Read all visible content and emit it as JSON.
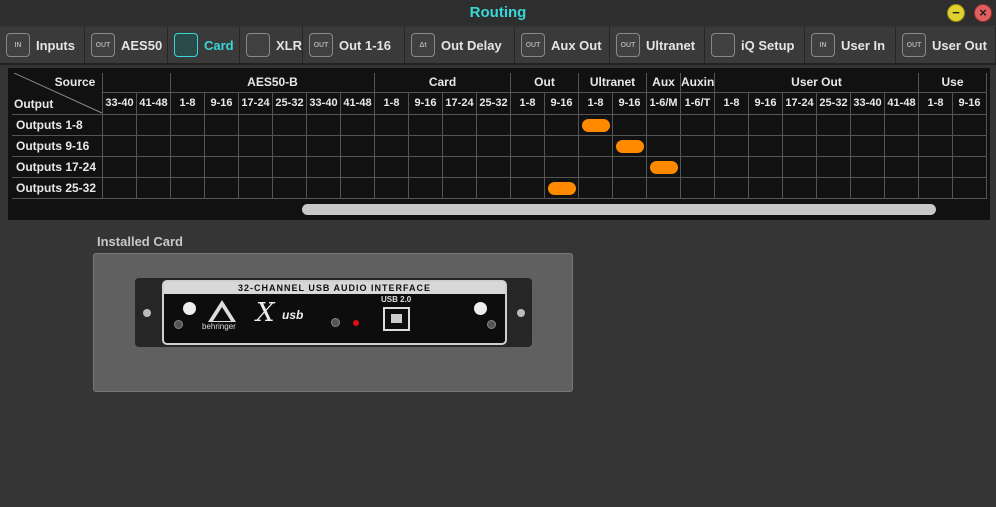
{
  "window": {
    "title": "Routing",
    "minimize_glyph": "−",
    "close_glyph": "×"
  },
  "tabs": [
    {
      "label": "Inputs",
      "icon": "in-connector-icon",
      "icon_text": "IN"
    },
    {
      "label": "AES50",
      "icon": "out-connector-icon",
      "icon_text": "OUT"
    },
    {
      "label": "Card",
      "icon": "card-icon",
      "icon_text": "",
      "active": true
    },
    {
      "label": "XLR",
      "icon": "xlr-icon",
      "icon_text": ""
    },
    {
      "label": "Out 1-16",
      "icon": "out-connector-icon",
      "icon_text": "OUT"
    },
    {
      "label": "Out Delay",
      "icon": "delay-icon",
      "icon_text": "Δt"
    },
    {
      "label": "Aux Out",
      "icon": "out-connector-icon",
      "icon_text": "OUT"
    },
    {
      "label": "Ultranet",
      "icon": "out-connector-icon",
      "icon_text": "OUT"
    },
    {
      "label": "iQ Setup",
      "icon": "speaker-icon",
      "icon_text": ""
    },
    {
      "label": "User In",
      "icon": "in-connector-icon",
      "icon_text": "IN"
    },
    {
      "label": "User Out",
      "icon": "out-connector-icon",
      "icon_text": "OUT"
    }
  ],
  "matrix": {
    "corner_source": "Source",
    "corner_output": "Output",
    "groups": [
      {
        "label": "",
        "span": 2
      },
      {
        "label": "AES50-B",
        "span": 6
      },
      {
        "label": "Card",
        "span": 4
      },
      {
        "label": "Out",
        "span": 2
      },
      {
        "label": "Ultranet",
        "span": 2
      },
      {
        "label": "Aux",
        "span": 1
      },
      {
        "label": "Auxin",
        "span": 1
      },
      {
        "label": "User Out",
        "span": 6
      },
      {
        "label": "Use",
        "span": 2
      }
    ],
    "columns": [
      "33-40",
      "41-48",
      "1-8",
      "9-16",
      "17-24",
      "25-32",
      "33-40",
      "41-48",
      "1-8",
      "9-16",
      "17-24",
      "25-32",
      "1-8",
      "9-16",
      "1-8",
      "9-16",
      "1-6/M",
      "1-6/T",
      "1-8",
      "9-16",
      "17-24",
      "25-32",
      "33-40",
      "41-48",
      "1-8",
      "9-16"
    ],
    "rows": [
      "Outputs 1-8",
      "Outputs 9-16",
      "Outputs 17-24",
      "Outputs 25-32"
    ],
    "selections": [
      {
        "row": 0,
        "col": 14
      },
      {
        "row": 1,
        "col": 15
      },
      {
        "row": 2,
        "col": 16
      },
      {
        "row": 3,
        "col": 13
      }
    ]
  },
  "installed_card": {
    "section_label": "Installed Card",
    "card_title": "32-CHANNEL USB AUDIO INTERFACE",
    "brand": "behringer",
    "product_logo": "X",
    "product_logo_suffix": "usb",
    "port_label": "USB 2.0"
  }
}
